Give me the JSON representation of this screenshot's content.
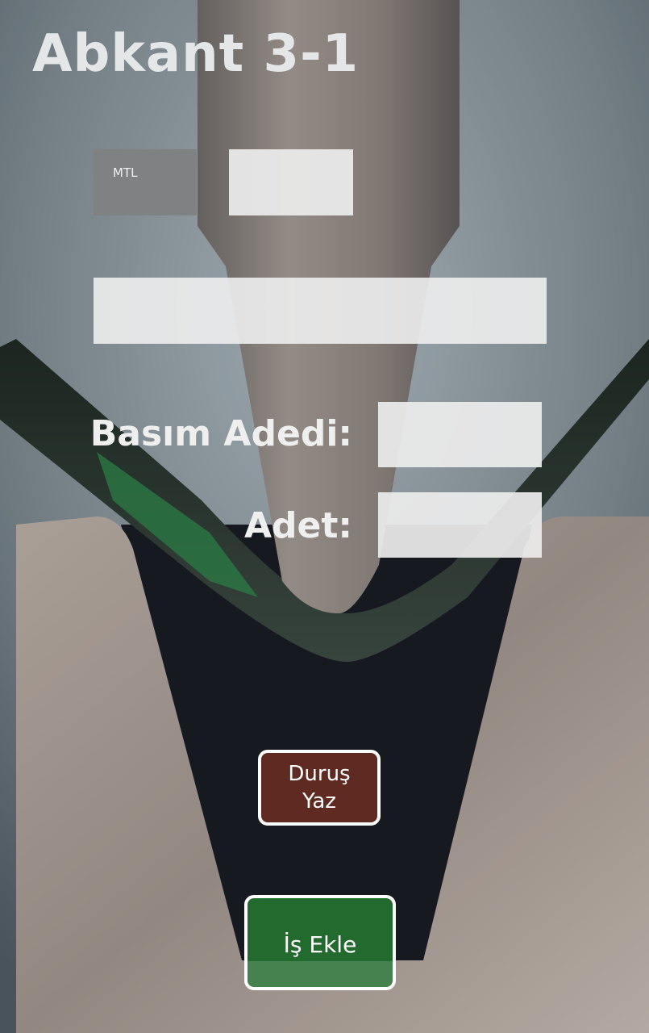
{
  "app": {
    "title": "Abkant 3-1"
  },
  "form": {
    "mtl_label": "MTL",
    "mtl_value": "",
    "info_value": "",
    "basim_adedi_label": "Basım Adedi:",
    "basim_adedi_value": "",
    "adet_label": "Adet:",
    "adet_value": ""
  },
  "buttons": {
    "durus_yaz": "Duruş Yaz",
    "is_ekle": "İş Ekle"
  },
  "colors": {
    "durus_button": "#5e2a22",
    "is_ekle_button": "#236a2e",
    "button_border": "#ffffff",
    "field_background": "#ececec"
  }
}
